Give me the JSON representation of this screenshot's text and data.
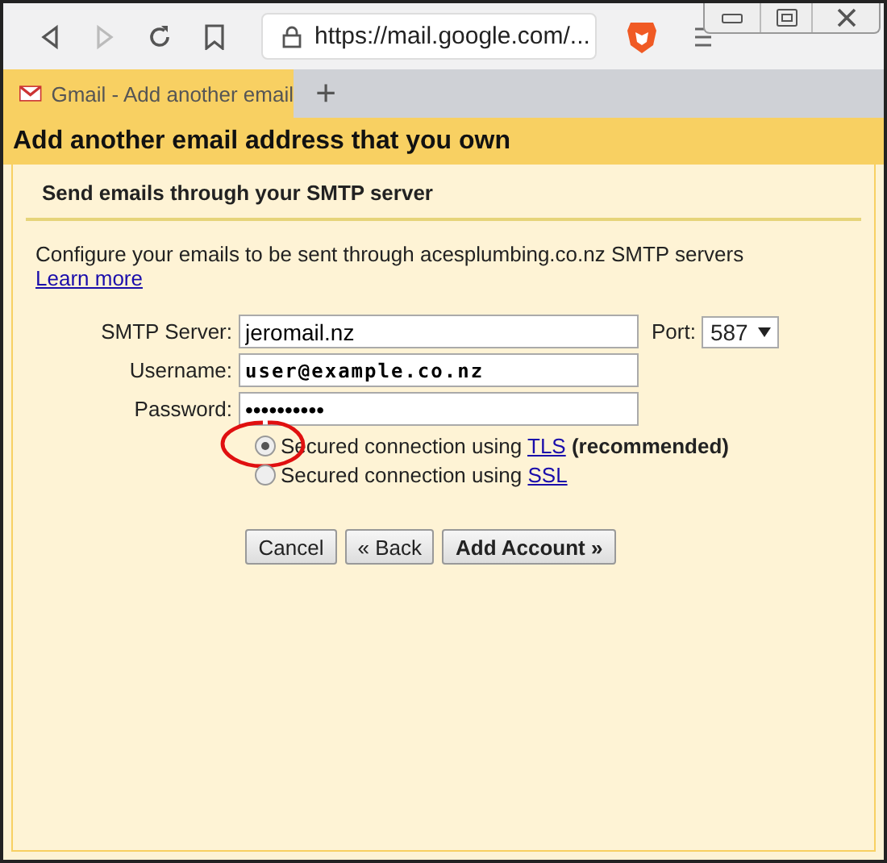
{
  "browser": {
    "url": "https://mail.google.com/...",
    "tab_title": "Gmail - Add another email",
    "new_tab": "+"
  },
  "page": {
    "title": "Add another email address that you own",
    "section": "Send emails through your SMTP server",
    "intro": "Configure your emails to be sent through acesplumbing.co.nz SMTP servers",
    "intro_link": "Learn more",
    "fields": [
      {
        "label": "SMTP Server:",
        "value": "jeromail.nz",
        "kind": "text"
      },
      {
        "label": "Username:",
        "value": "user@example.co.nz",
        "kind": "mono"
      },
      {
        "label": "Password:",
        "value": "••••••••••",
        "kind": "password"
      }
    ],
    "port": {
      "label": "Port:",
      "value": "587"
    },
    "options": [
      {
        "text": "Secured connection using",
        "link": "TLS",
        "note": "(recommended)",
        "selected": true,
        "circled": true
      },
      {
        "text": "Secured connection using",
        "link": "SSL",
        "selected": false,
        "circled": false
      }
    ],
    "buttons": [
      {
        "label": "Cancel",
        "kind": "normal"
      },
      {
        "label": "« Back",
        "kind": "normal"
      },
      {
        "label": "Add Account »",
        "kind": "primary"
      }
    ]
  }
}
